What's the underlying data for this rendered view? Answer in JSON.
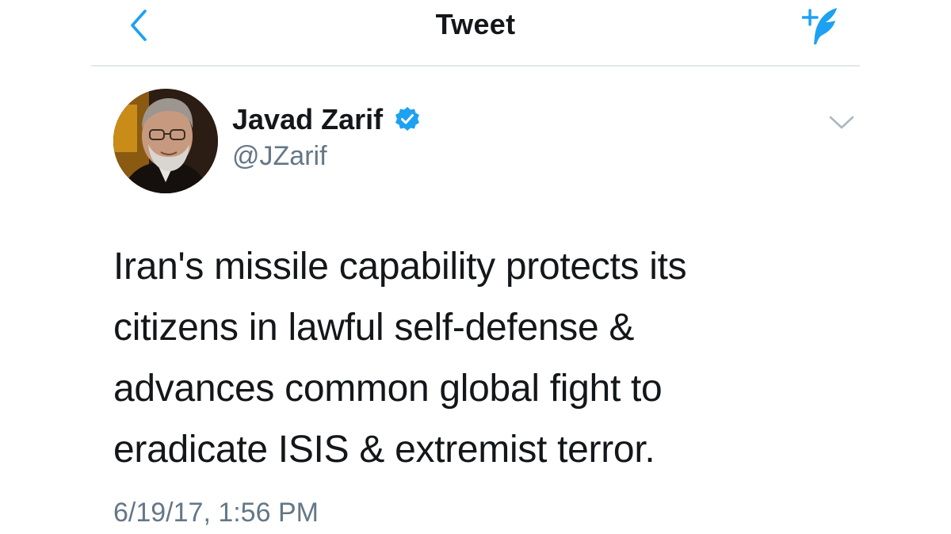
{
  "header": {
    "title": "Tweet",
    "back_icon": "chevron-left-icon",
    "compose_icon": "compose-tweet-icon"
  },
  "tweet": {
    "author": {
      "name": "Javad Zarif",
      "handle": "@JZarif",
      "verified": true,
      "avatar": "profile-photo"
    },
    "text": "Iran's missile capability protects its\ncitizens in lawful self-defense &\nadvances common global fight to\neradicate ISIS & extremist terror.",
    "timestamp": "6/19/17, 1:56 PM",
    "menu_icon": "chevron-down-icon"
  },
  "colors": {
    "accent": "#1da1f2",
    "text_primary": "#14171a",
    "text_secondary": "#657786",
    "divider": "#e1e8ed"
  }
}
